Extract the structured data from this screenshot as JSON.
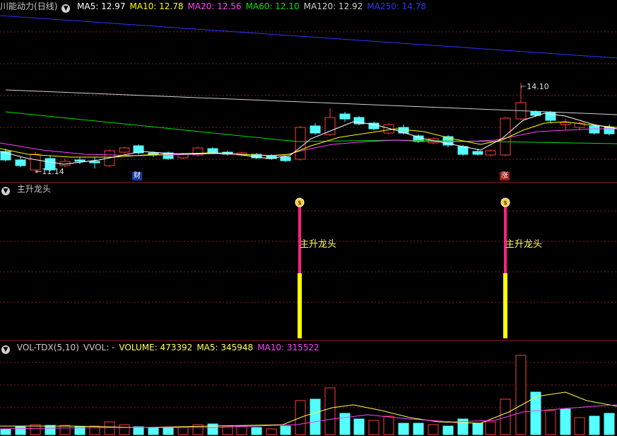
{
  "price_panel": {
    "stock_name": "川能动力",
    "period": "(日线)",
    "indicators": [
      {
        "label": "MA5: 12.97",
        "color": "#ffffff"
      },
      {
        "label": "MA10: 12.78",
        "color": "#ffff00"
      },
      {
        "label": "MA20: 12.56",
        "color": "#ff40ff"
      },
      {
        "label": "MA60: 12.10",
        "color": "#00e000"
      },
      {
        "label": "MA120: 12.92",
        "color": "#d0d0d0"
      },
      {
        "label": "MA250: 14.78",
        "color": "#3333ff"
      }
    ],
    "high_label": "14.10",
    "low_label": "11.14",
    "marker_cai": "财",
    "marker_zhang": "涨"
  },
  "signal_panel": {
    "title": "主升龙头",
    "signal_text": "主升龙头",
    "signal_icon": "money-bag-icon"
  },
  "volume_panel": {
    "indicators": [
      {
        "label": "VOL-TDX(5,10)",
        "color": "#c8c8c8"
      },
      {
        "label": "VVOL: -",
        "color": "#c8c8c8"
      },
      {
        "label": "VOLUME: 473392",
        "color": "#ffff55"
      },
      {
        "label": "MA5: 345948",
        "color": "#ffff55"
      },
      {
        "label": "MA10: 315522",
        "color": "#ff40ff"
      }
    ]
  },
  "colors": {
    "up": "#ff3b3b",
    "down": "#54ffff",
    "grid": "#8a1a1a",
    "signal_bar": "#ffff00",
    "signal_line": "#ff2080"
  }
}
